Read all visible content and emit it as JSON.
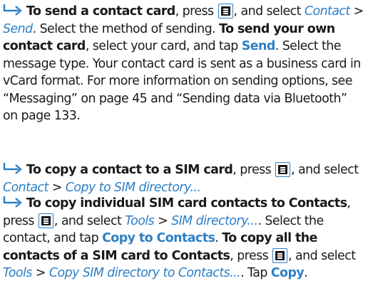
{
  "colors": {
    "accent": "#2d7fc6",
    "text": "#1a1a1a"
  },
  "icons": {
    "bullet": "bent-arrow-icon",
    "menu_key": "menu-key-icon"
  },
  "para1": {
    "bold1": "To send a contact card",
    "t1": ", press ",
    "t2": ", and select ",
    "link1": "Contact",
    "t3": " > ",
    "link2": "Send",
    "t4": ". Select the method of sending. ",
    "bold2": "To send your own contact card",
    "t5": ", select your card, and tap ",
    "button1": "Send",
    "t6": ". Select the message type. Your contact card is sent as a business card in vCard format. For more information on sending options, see “Messaging” on page 45 and “Sending data via Bluetooth” on page 133."
  },
  "para2": {
    "bold1": "To copy a contact to a SIM card",
    "t1": ", press ",
    "t2": ", and select ",
    "link1": "Contact",
    "t3": " > ",
    "link2": "Copy to SIM directory..."
  },
  "para3": {
    "bold1": "To copy individual SIM card contacts to Contacts",
    "t1": ", press ",
    "t2": ", and select ",
    "link1": "Tools",
    "t3": " > ",
    "link2": "SIM directory...",
    "t4": ". Select the contact, and tap ",
    "button1": "Copy to Contacts",
    "t5": ". ",
    "bold2": "To copy all the contacts of a SIM card to Contacts",
    "t6": ", press ",
    "t7": ", and select ",
    "link3": "Tools",
    "t8": " > ",
    "link4": "Copy SIM directory to Contacts...",
    "t9": ". Tap ",
    "button2": "Copy",
    "t10": "."
  }
}
